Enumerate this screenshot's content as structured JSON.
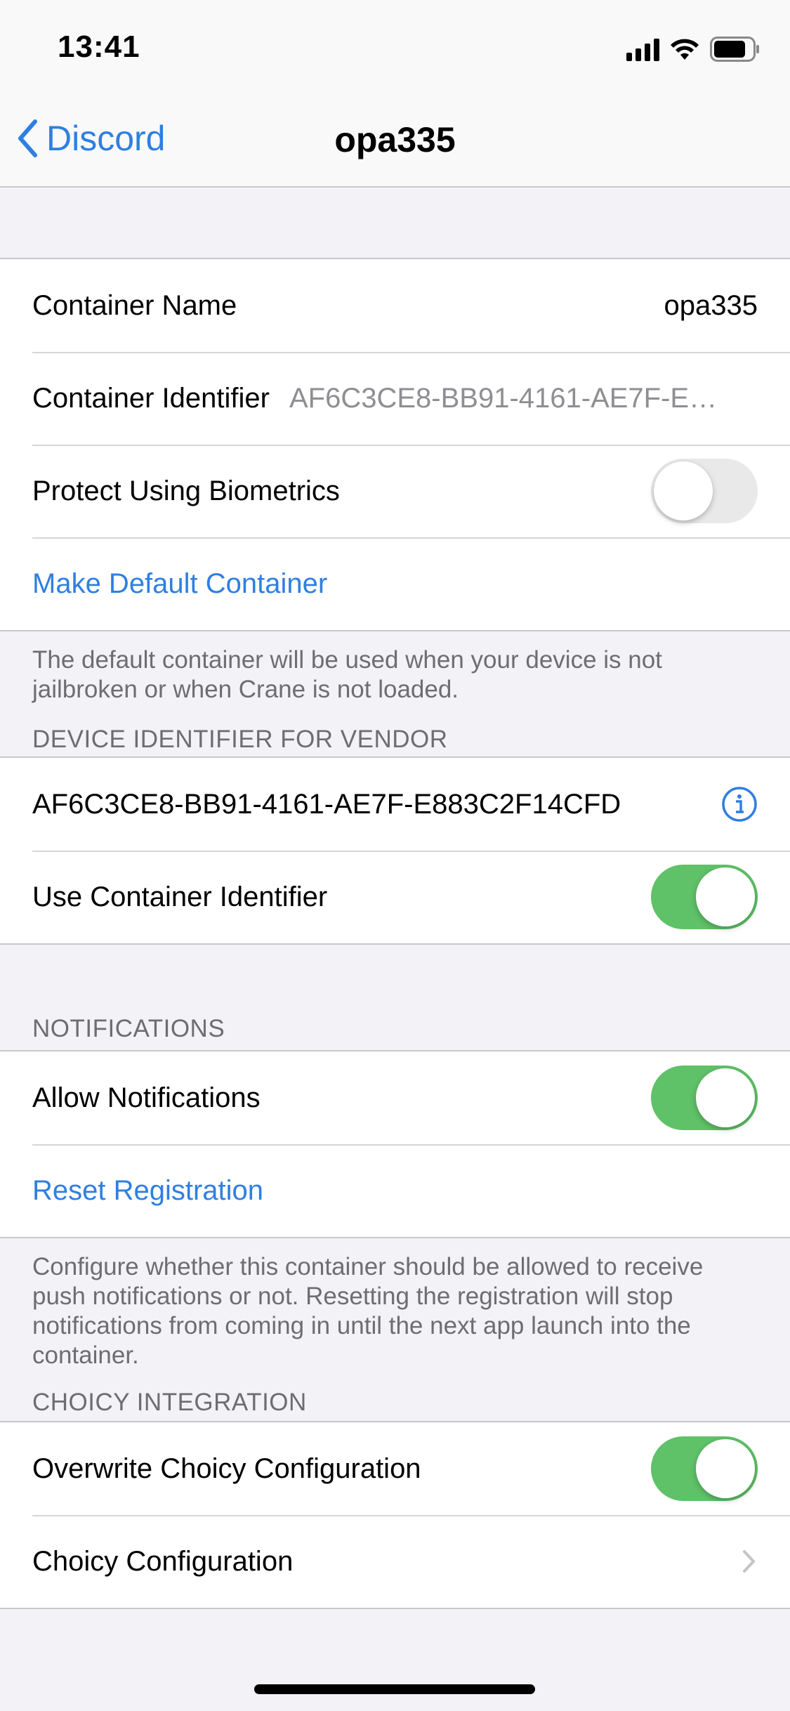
{
  "status_bar": {
    "time": "13:41"
  },
  "nav": {
    "back_label": "Discord",
    "title": "opa335"
  },
  "container": {
    "name_label": "Container Name",
    "name_value": "opa335",
    "identifier_label": "Container Identifier",
    "identifier_value": "AF6C3CE8-BB91-4161-AE7F-E…",
    "biometrics_label": "Protect Using Biometrics",
    "biometrics_on": false,
    "make_default_label": "Make Default Container",
    "footer": "The default container will be used when your device is not jailbroken or when Crane is not loaded."
  },
  "vendor": {
    "header": "DEVICE IDENTIFIER FOR VENDOR",
    "identifier": "AF6C3CE8-BB91-4161-AE7F-E883C2F14CFD",
    "info_icon": "info-icon",
    "use_container_label": "Use Container Identifier",
    "use_container_on": true
  },
  "notifications": {
    "header": "NOTIFICATIONS",
    "allow_label": "Allow Notifications",
    "allow_on": true,
    "reset_label": "Reset Registration",
    "footer": "Configure whether this container should be allowed to receive push notifications or not. Resetting the registration will stop notifications from coming in until the next app launch into the container."
  },
  "choicy": {
    "header": "CHOICY INTEGRATION",
    "overwrite_label": "Overwrite Choicy Configuration",
    "overwrite_on": true,
    "config_label": "Choicy Configuration"
  },
  "colors": {
    "accent": "#2f7fe0",
    "toggle_on": "#5fc168",
    "toggle_off": "#e9e9ea"
  }
}
